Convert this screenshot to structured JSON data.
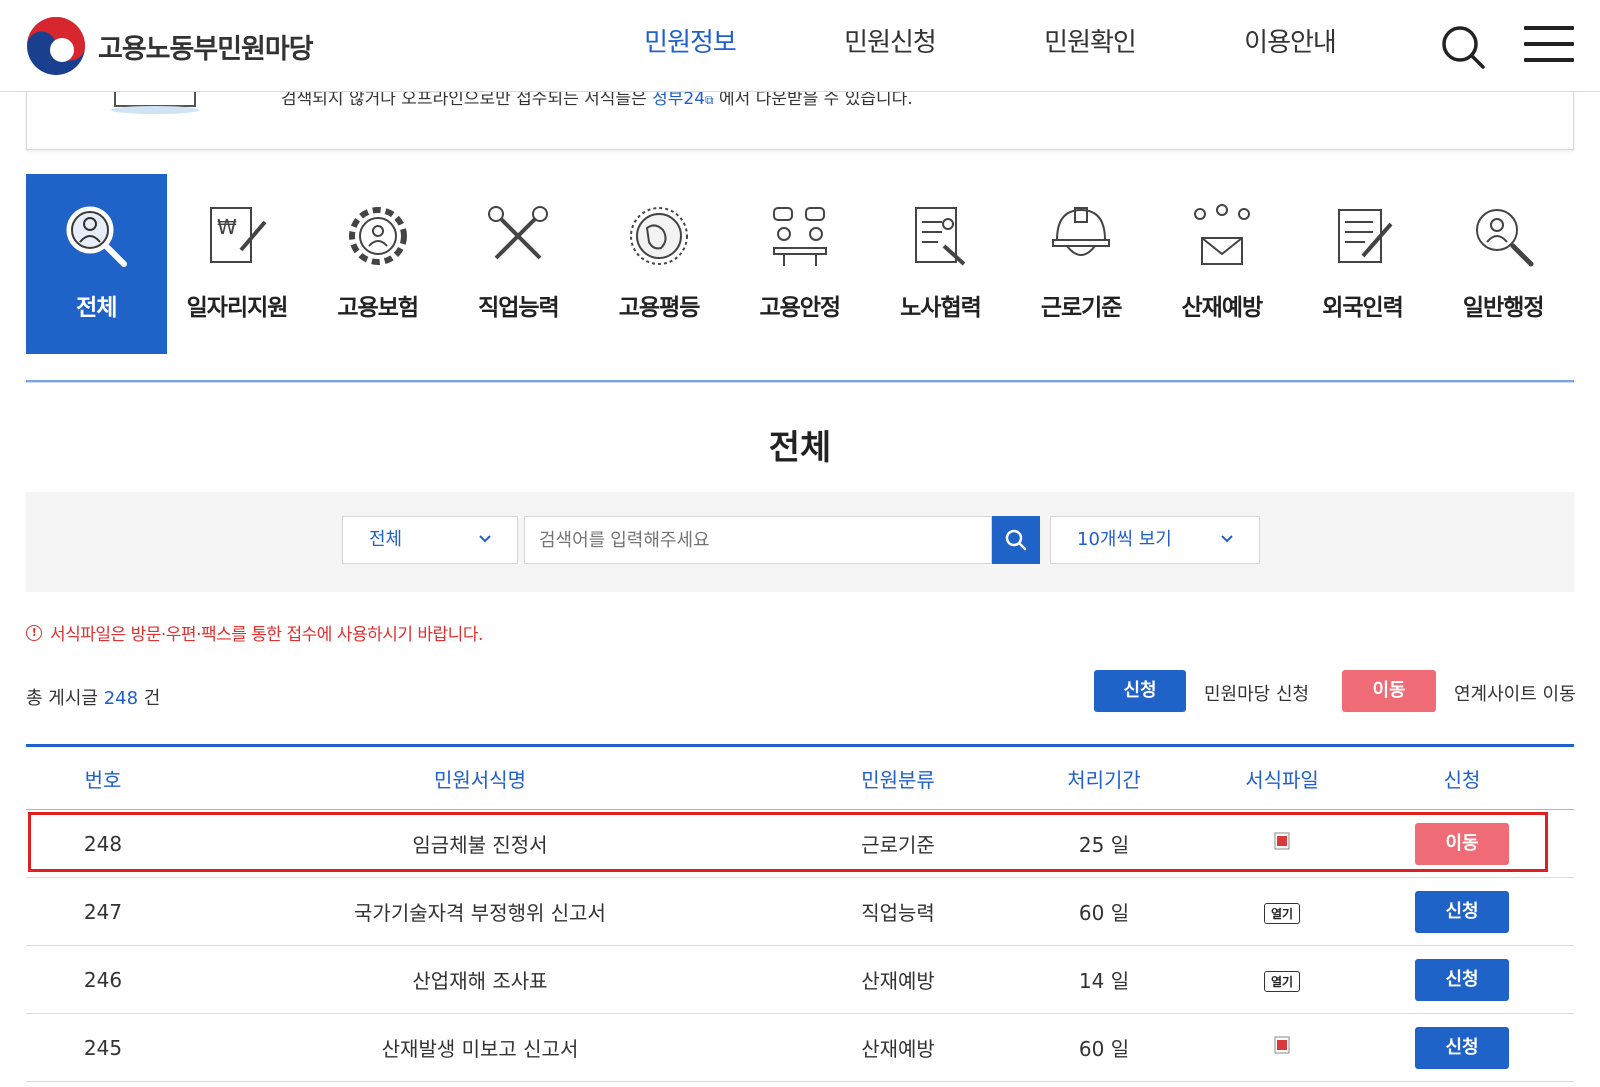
{
  "header": {
    "logo_text": "고용노동부민원마당",
    "nav": [
      "민원정보",
      "민원신청",
      "민원확인",
      "이용안내"
    ],
    "active_nav": 0
  },
  "notice": {
    "text_before": "검색되지 않거나 오프라인으로만 접수되는 서식들은 ",
    "link": "정부24",
    "text_after": " 에서 다운받을 수 있습니다."
  },
  "categories": [
    {
      "label": "전체",
      "icon": "magnifier-person-icon",
      "active": true
    },
    {
      "label": "일자리지원",
      "icon": "document-pen-won-icon",
      "active": false
    },
    {
      "label": "고용보험",
      "icon": "gear-person-icon",
      "active": false
    },
    {
      "label": "직업능력",
      "icon": "tools-icon",
      "active": false
    },
    {
      "label": "고용평등",
      "icon": "globe-icon",
      "active": false
    },
    {
      "label": "고용안정",
      "icon": "meeting-people-icon",
      "active": false
    },
    {
      "label": "노사협력",
      "icon": "document-person-icon",
      "active": false
    },
    {
      "label": "근로기준",
      "icon": "helmet-icon",
      "active": false
    },
    {
      "label": "산재예방",
      "icon": "people-envelope-icon",
      "active": false
    },
    {
      "label": "외국인력",
      "icon": "document-pencil-icon",
      "active": false
    },
    {
      "label": "일반행정",
      "icon": "magnifier-person-icon",
      "active": false
    }
  ],
  "page_title": "전체",
  "search": {
    "category_value": "전체",
    "placeholder": "검색어를 입력해주세요",
    "rows_value": "10개씩 보기"
  },
  "warning": "서식파일은 방문·우편·팩스를 통한 접수에 사용하시기 바랍니다.",
  "total": {
    "prefix": "총 게시글",
    "count": "248",
    "suffix": "건"
  },
  "legend": {
    "apply_btn": "신청",
    "apply_label": "민원마당 신청",
    "move_btn": "이동",
    "move_label": "연계사이트 이동"
  },
  "table": {
    "headers": [
      "번호",
      "민원서식명",
      "민원분류",
      "처리기간",
      "서식파일",
      "신청"
    ],
    "rows": [
      {
        "no": "248",
        "name": "임금체불 진정서",
        "category": "근로기준",
        "period": "25 일",
        "file": "hwp-file-icon",
        "action": "이동",
        "action_type": "move",
        "highlighted": true
      },
      {
        "no": "247",
        "name": "국가기술자격 부정행위 신고서",
        "category": "직업능력",
        "period": "60 일",
        "file": "열기",
        "action": "신청",
        "action_type": "apply",
        "highlighted": false
      },
      {
        "no": "246",
        "name": "산업재해 조사표",
        "category": "산재예방",
        "period": "14 일",
        "file": "열기",
        "action": "신청",
        "action_type": "apply",
        "highlighted": false
      },
      {
        "no": "245",
        "name": "산재발생 미보고 신고서",
        "category": "산재예방",
        "period": "60 일",
        "file": "hwp-file-icon",
        "action": "신청",
        "action_type": "apply",
        "highlighted": false
      }
    ]
  },
  "colors": {
    "brand_blue": "#1f62c8",
    "move_red": "#ef6b76",
    "warning_red": "#e03030",
    "highlight_red": "#e02020"
  }
}
